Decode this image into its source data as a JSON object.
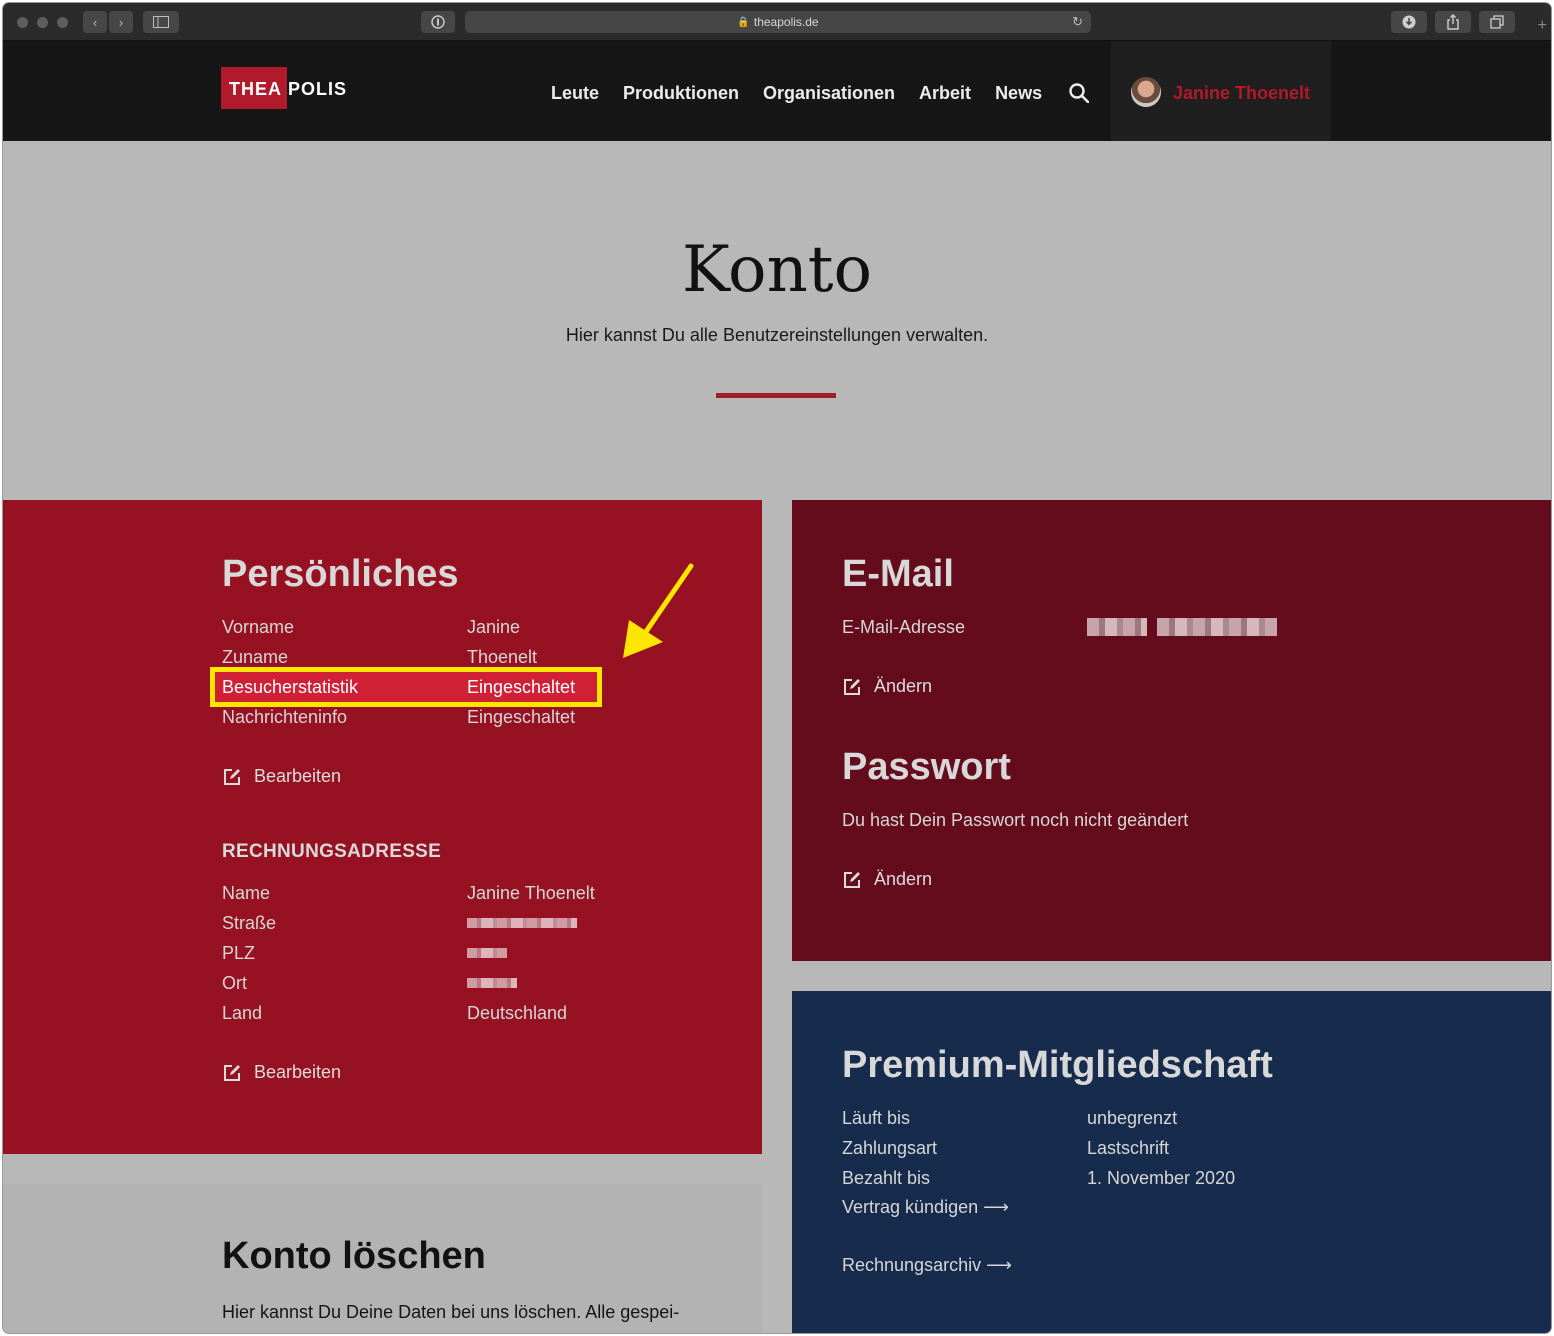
{
  "browser": {
    "url": "theapolis.de"
  },
  "header": {
    "logo_left": "THEA",
    "logo_right": "POLIS",
    "nav": [
      "Leute",
      "Produktionen",
      "Organisationen",
      "Arbeit",
      "News"
    ],
    "user_name": "Janine Thoenelt"
  },
  "hero": {
    "title": "Konto",
    "subtitle": "Hier kannst Du alle Benutzereinstellungen verwalten."
  },
  "personal": {
    "title": "Persönliches",
    "rows": [
      {
        "label": "Vorname",
        "value": "Janine"
      },
      {
        "label": "Zuname",
        "value": "Thoenelt"
      },
      {
        "label": "Besucherstatistik",
        "value": "Eingeschaltet"
      },
      {
        "label": "Nachrichteninfo",
        "value": "Eingeschaltet"
      }
    ],
    "edit_label": "Bearbeiten",
    "billing_title": "RECHNUNGSADRESSE",
    "billing_rows": [
      {
        "label": "Name",
        "value": "Janine Thoenelt"
      },
      {
        "label": "Straße",
        "value": ""
      },
      {
        "label": "PLZ",
        "value": ""
      },
      {
        "label": "Ort",
        "value": ""
      },
      {
        "label": "Land",
        "value": "Deutschland"
      }
    ],
    "billing_edit_label": "Bearbeiten"
  },
  "email": {
    "title": "E-Mail",
    "label": "E-Mail-Adresse",
    "change_label": "Ändern"
  },
  "password": {
    "title": "Passwort",
    "text": "Du hast Dein Passwort noch nicht geändert",
    "change_label": "Ändern"
  },
  "premium": {
    "title": "Premium-Mitgliedschaft",
    "rows": [
      {
        "label": "Läuft bis",
        "value": "unbegrenzt"
      },
      {
        "label": "Zahlungsart",
        "value": "Lastschrift"
      },
      {
        "label": "Bezahlt bis",
        "value": "1. November 2020"
      }
    ],
    "cancel_link": "Vertrag kündigen",
    "archive_link": "Rechnungsarchiv"
  },
  "delete": {
    "title": "Konto löschen",
    "text": "Hier kannst Du Deine Daten bei uns löschen. Alle gespei-"
  },
  "colors": {
    "brand_red": "#b11a2b",
    "panel_red": "#961222",
    "panel_wine": "#640c1c",
    "panel_navy": "#172b4d",
    "highlight": "#ffe600"
  }
}
